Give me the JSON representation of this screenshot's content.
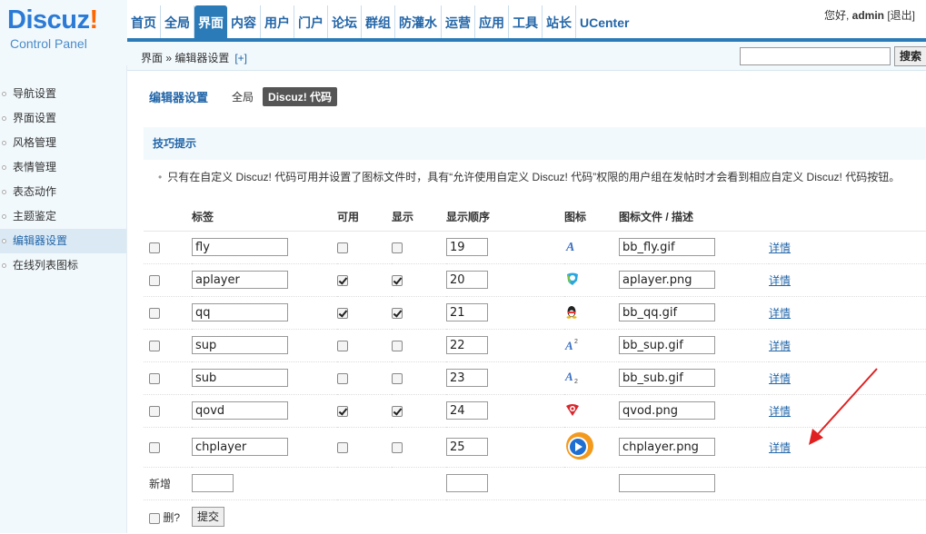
{
  "logo": {
    "brand": "Discuz",
    "mark": "!",
    "subtitle": "Control Panel"
  },
  "nav": [
    {
      "label": "首页"
    },
    {
      "label": "全局"
    },
    {
      "label": "界面",
      "active": true
    },
    {
      "label": "内容"
    },
    {
      "label": "用户"
    },
    {
      "label": "门户"
    },
    {
      "label": "论坛"
    },
    {
      "label": "群组"
    },
    {
      "label": "防灌水"
    },
    {
      "label": "运营"
    },
    {
      "label": "应用"
    },
    {
      "label": "工具"
    },
    {
      "label": "站长"
    },
    {
      "label": "UCenter"
    }
  ],
  "user": {
    "greeting": "您好,",
    "name": "admin",
    "logout": "[退出]"
  },
  "breadcrumb": {
    "text": "界面 » 编辑器设置",
    "plus": "[+]"
  },
  "search": {
    "button": "搜索",
    "value": ""
  },
  "sidebar": {
    "items": [
      {
        "label": "导航设置"
      },
      {
        "label": "界面设置"
      },
      {
        "label": "风格管理"
      },
      {
        "label": "表情管理"
      },
      {
        "label": "表态动作"
      },
      {
        "label": "主题鉴定"
      },
      {
        "label": "编辑器设置",
        "active": true
      },
      {
        "label": "在线列表图标"
      }
    ]
  },
  "subnav": {
    "title": "编辑器设置",
    "tab1": "全局",
    "tab2": "Discuz! 代码"
  },
  "tips": {
    "title": "技巧提示",
    "text": "只有在自定义 Discuz! 代码可用并设置了图标文件时，具有“允许使用自定义 Discuz! 代码”权限的用户组在发帖时才会看到相应自定义 Discuz! 代码按钮。",
    "bullet": "•"
  },
  "table": {
    "headers": {
      "tag": "标签",
      "enabled": "可用",
      "shown": "显示",
      "order": "显示顺序",
      "icon": "图标",
      "file": "图标文件 / 描述"
    },
    "rows": [
      {
        "tag": "fly",
        "enabled": false,
        "shown": false,
        "order": "19",
        "icon": "fly-icon",
        "file": "bb_fly.gif",
        "detail": "详情"
      },
      {
        "tag": "aplayer",
        "enabled": true,
        "shown": true,
        "order": "20",
        "icon": "aplayer-icon",
        "file": "aplayer.png",
        "detail": "详情"
      },
      {
        "tag": "qq",
        "enabled": true,
        "shown": true,
        "order": "21",
        "icon": "qq-penguin-icon",
        "file": "bb_qq.gif",
        "detail": "详情"
      },
      {
        "tag": "sup",
        "enabled": false,
        "shown": false,
        "order": "22",
        "icon": "superscript-icon",
        "file": "bb_sup.gif",
        "detail": "详情"
      },
      {
        "tag": "sub",
        "enabled": false,
        "shown": false,
        "order": "23",
        "icon": "subscript-icon",
        "file": "bb_sub.gif",
        "detail": "详情"
      },
      {
        "tag": "qovd",
        "enabled": true,
        "shown": true,
        "order": "24",
        "icon": "qvod-icon",
        "file": "qvod.png",
        "detail": "详情"
      },
      {
        "tag": "chplayer",
        "enabled": false,
        "shown": false,
        "order": "25",
        "icon": "chplayer-icon",
        "file": "chplayer.png",
        "detail": "详情"
      }
    ],
    "new_label": "新增",
    "delete_label": "删?",
    "submit_label": "提交"
  },
  "colors": {
    "accent": "#2b7bb8",
    "link": "#2366a8",
    "arrow": "#e02020"
  }
}
